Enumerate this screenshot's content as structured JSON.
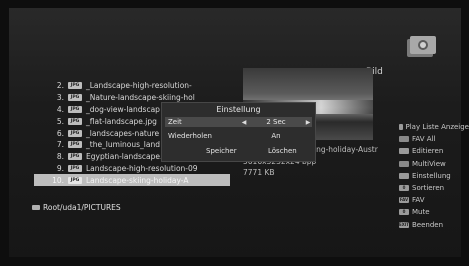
{
  "header": {
    "title": "Bild",
    "app_icon": "picture-viewer-icon"
  },
  "files": [
    {
      "num": "2.",
      "badge": "JPG",
      "name": "_Landscape-high-resolution-",
      "selected": false
    },
    {
      "num": "3.",
      "badge": "JPG",
      "name": "_Nature-landscape-skiing-hol",
      "selected": false
    },
    {
      "num": "4.",
      "badge": "JPG",
      "name": "_dog-view-landscap",
      "selected": false
    },
    {
      "num": "5.",
      "badge": "JPG",
      "name": "_flat-landscape.jpg",
      "selected": false
    },
    {
      "num": "6.",
      "badge": "JPG",
      "name": "_landscapes-nature",
      "selected": false
    },
    {
      "num": "7.",
      "badge": "JPG",
      "name": "_the_luminous_land",
      "selected": false
    },
    {
      "num": "8.",
      "badge": "JPG",
      "name": "Egyptian-landscape.jpg",
      "selected": false
    },
    {
      "num": "9.",
      "badge": "JPG",
      "name": "Landscape-high-resolution-09",
      "selected": false
    },
    {
      "num": "10.",
      "badge": "JPG",
      "name": "Landscape-skiing-holiday-A",
      "selected": true
    }
  ],
  "path": {
    "text": "Root/uda1/PICTURES"
  },
  "info": {
    "filename": "ing-holiday-Austr",
    "resolution": "5616x3232x24 bpp",
    "size": "7771 KB"
  },
  "dialog": {
    "title": "Einstellung",
    "row1": {
      "label": "Zeit",
      "value": "2 Sec"
    },
    "row2": {
      "label": "Wiederholen",
      "value": "An"
    },
    "save_label": "Speicher",
    "delete_label": "Löschen"
  },
  "menu": [
    {
      "key": "",
      "label": "Play Liste Anzeige"
    },
    {
      "key": "",
      "label": "FAV All"
    },
    {
      "key": "",
      "label": "Editieren"
    },
    {
      "key": "",
      "label": "MultiView"
    },
    {
      "key": "",
      "label": "Einstellung"
    },
    {
      "key": "0",
      "label": "Sortieren"
    },
    {
      "key": "FAV",
      "label": "FAV"
    },
    {
      "key": "0",
      "label": "Mute"
    },
    {
      "key": "EXIT",
      "label": "Beenden"
    }
  ]
}
